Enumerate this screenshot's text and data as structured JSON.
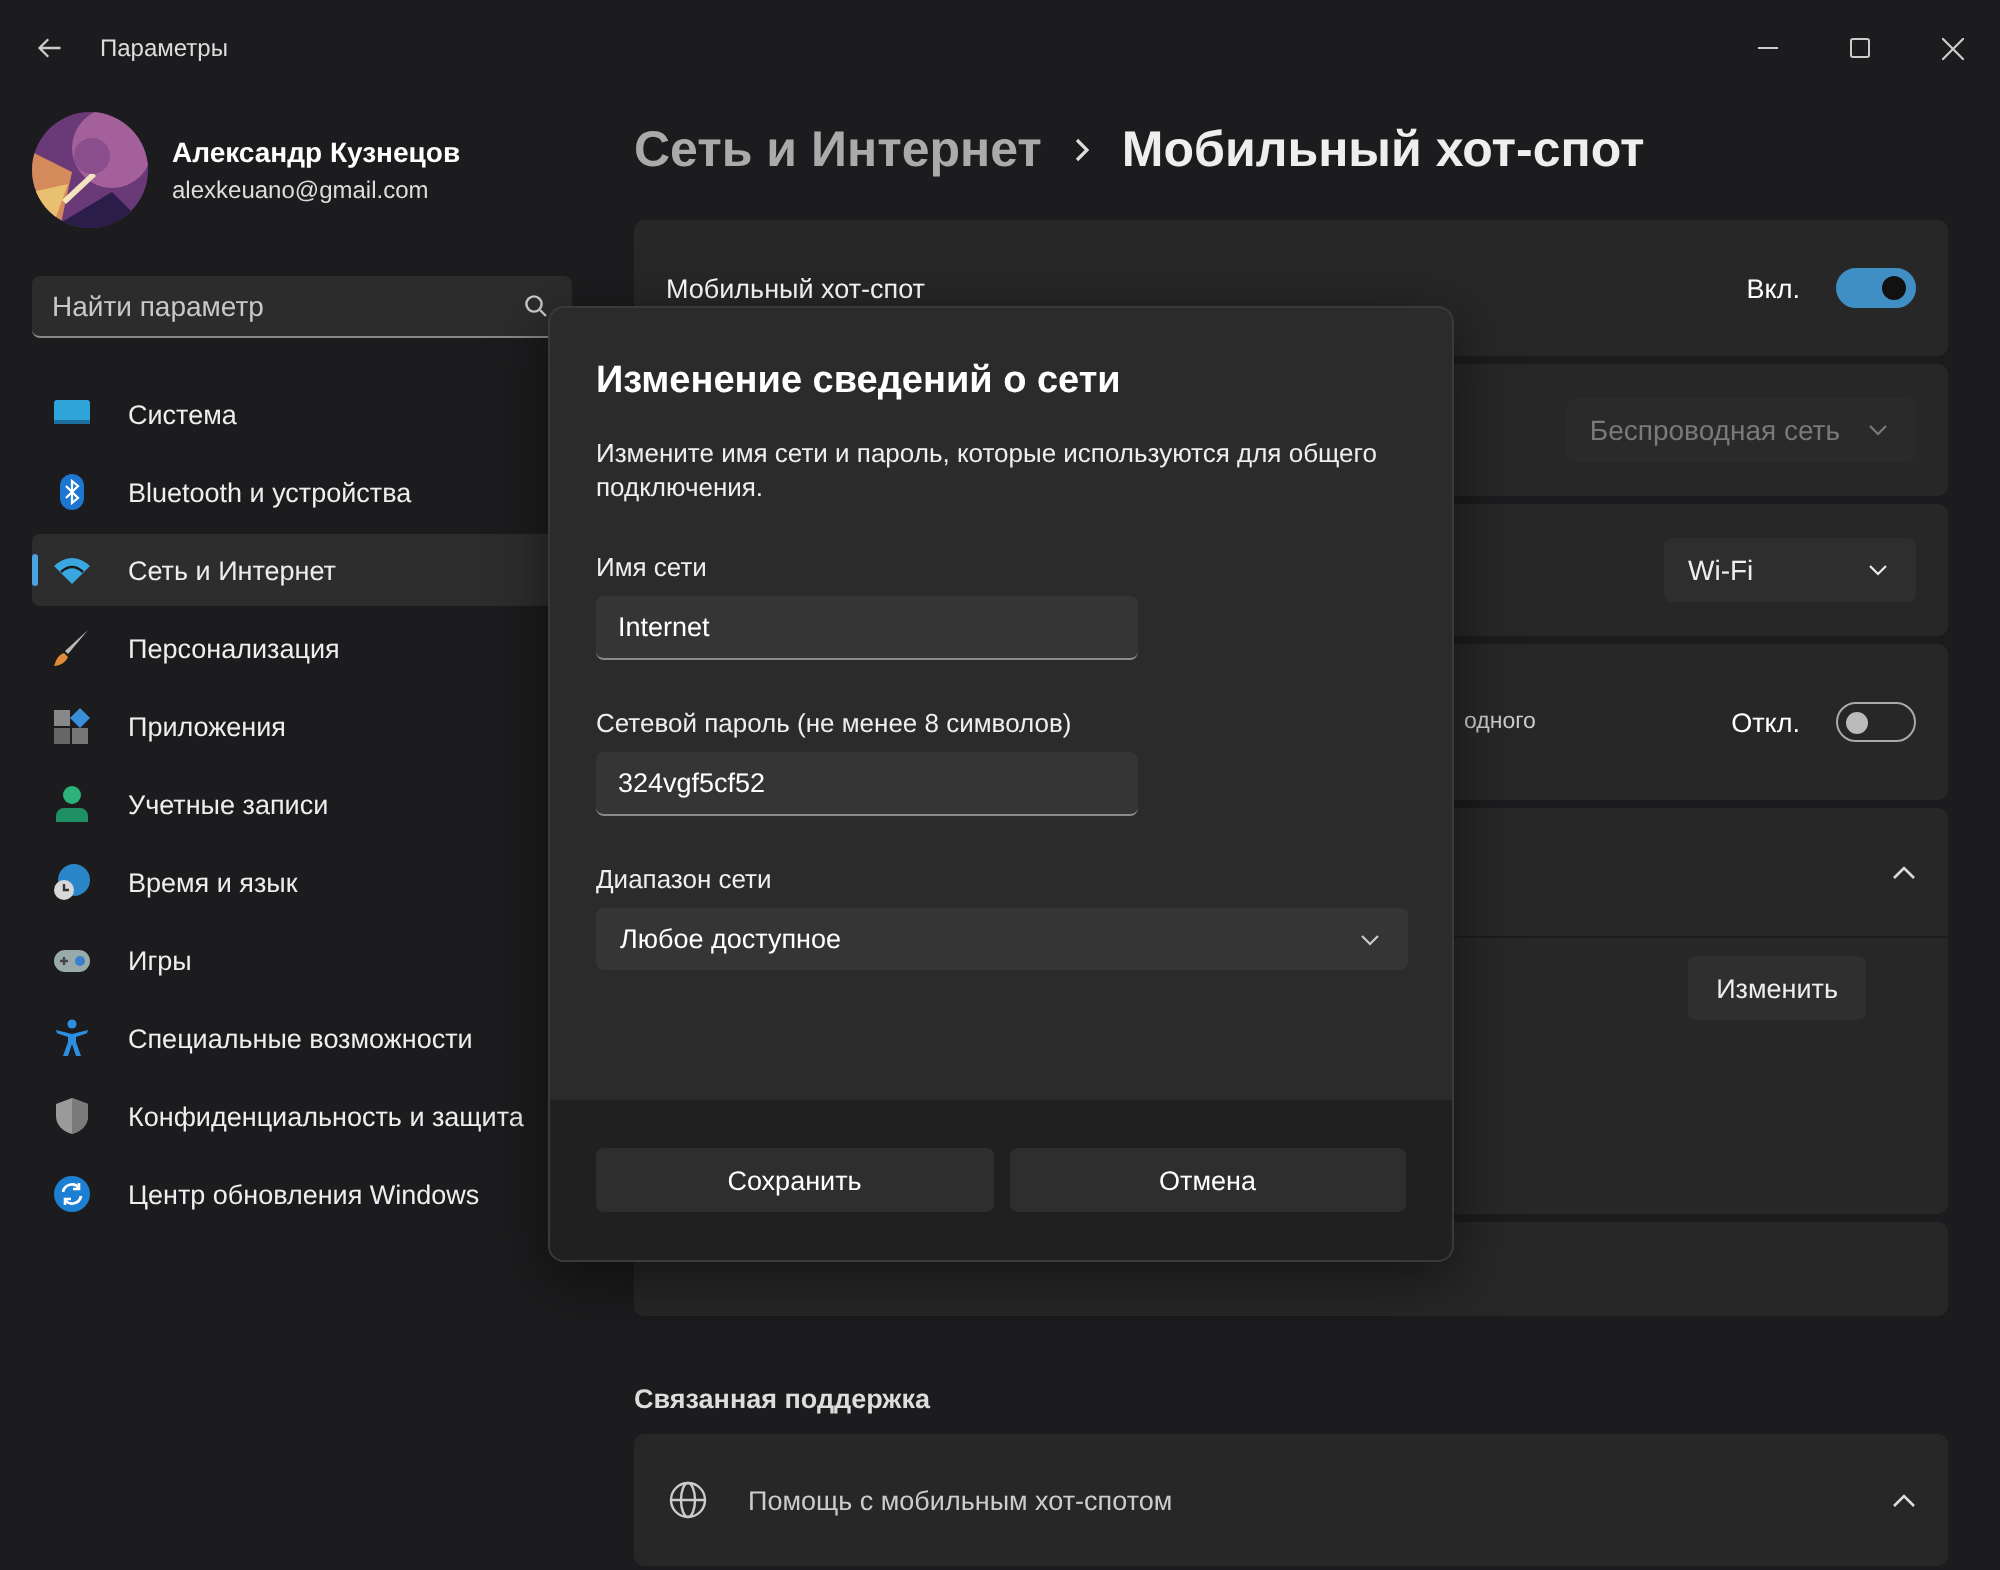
{
  "window": {
    "title": "Параметры"
  },
  "user": {
    "name": "Александр Кузнецов",
    "email": "alexkeuano@gmail.com"
  },
  "search": {
    "placeholder": "Найти параметр"
  },
  "sidebar": {
    "items": [
      {
        "label": "Система",
        "selected": false
      },
      {
        "label": "Bluetooth и устройства",
        "selected": false
      },
      {
        "label": "Сеть и Интернет",
        "selected": true
      },
      {
        "label": "Персонализация",
        "selected": false
      },
      {
        "label": "Приложения",
        "selected": false
      },
      {
        "label": "Учетные записи",
        "selected": false
      },
      {
        "label": "Время и язык",
        "selected": false
      },
      {
        "label": "Игры",
        "selected": false
      },
      {
        "label": "Специальные возможности",
        "selected": false
      },
      {
        "label": "Конфиденциальность и защита",
        "selected": false
      },
      {
        "label": "Центр обновления Windows",
        "selected": false
      }
    ]
  },
  "breadcrumb": [
    "Сеть и Интернет",
    "Мобильный хот-спот"
  ],
  "cards": [
    {
      "kind": "toggle",
      "label": "Мобильный хот-спот",
      "state_text": "Вкл.",
      "on": true
    },
    {
      "kind": "dropdown",
      "value": "Беспроводная сеть",
      "disabled": true
    },
    {
      "kind": "dropdown",
      "value": "Wi-Fi",
      "disabled": false
    },
    {
      "kind": "toggle",
      "label": "одного",
      "state_text": "Откл.",
      "on": false
    },
    {
      "kind": "expander",
      "expanded": true,
      "button": "Изменить"
    },
    {
      "kind": "plain"
    }
  ],
  "related": {
    "title": "Связанная поддержка",
    "items": [
      {
        "label": "Помощь с мобильным хот-спотом",
        "expanded": true
      }
    ]
  },
  "dialog": {
    "title": "Изменение сведений о сети",
    "description": "Измените имя сети и пароль, которые используются для общего подключения.",
    "fields": [
      {
        "kind": "text",
        "label": "Имя сети",
        "value": "Internet"
      },
      {
        "kind": "text",
        "label": "Сетевой пароль (не менее 8 символов)",
        "value": "324vgf5cf52"
      },
      {
        "kind": "select",
        "label": "Диапазон сети",
        "value": "Любое доступное"
      }
    ],
    "buttons": [
      "Сохранить",
      "Отмена"
    ]
  }
}
